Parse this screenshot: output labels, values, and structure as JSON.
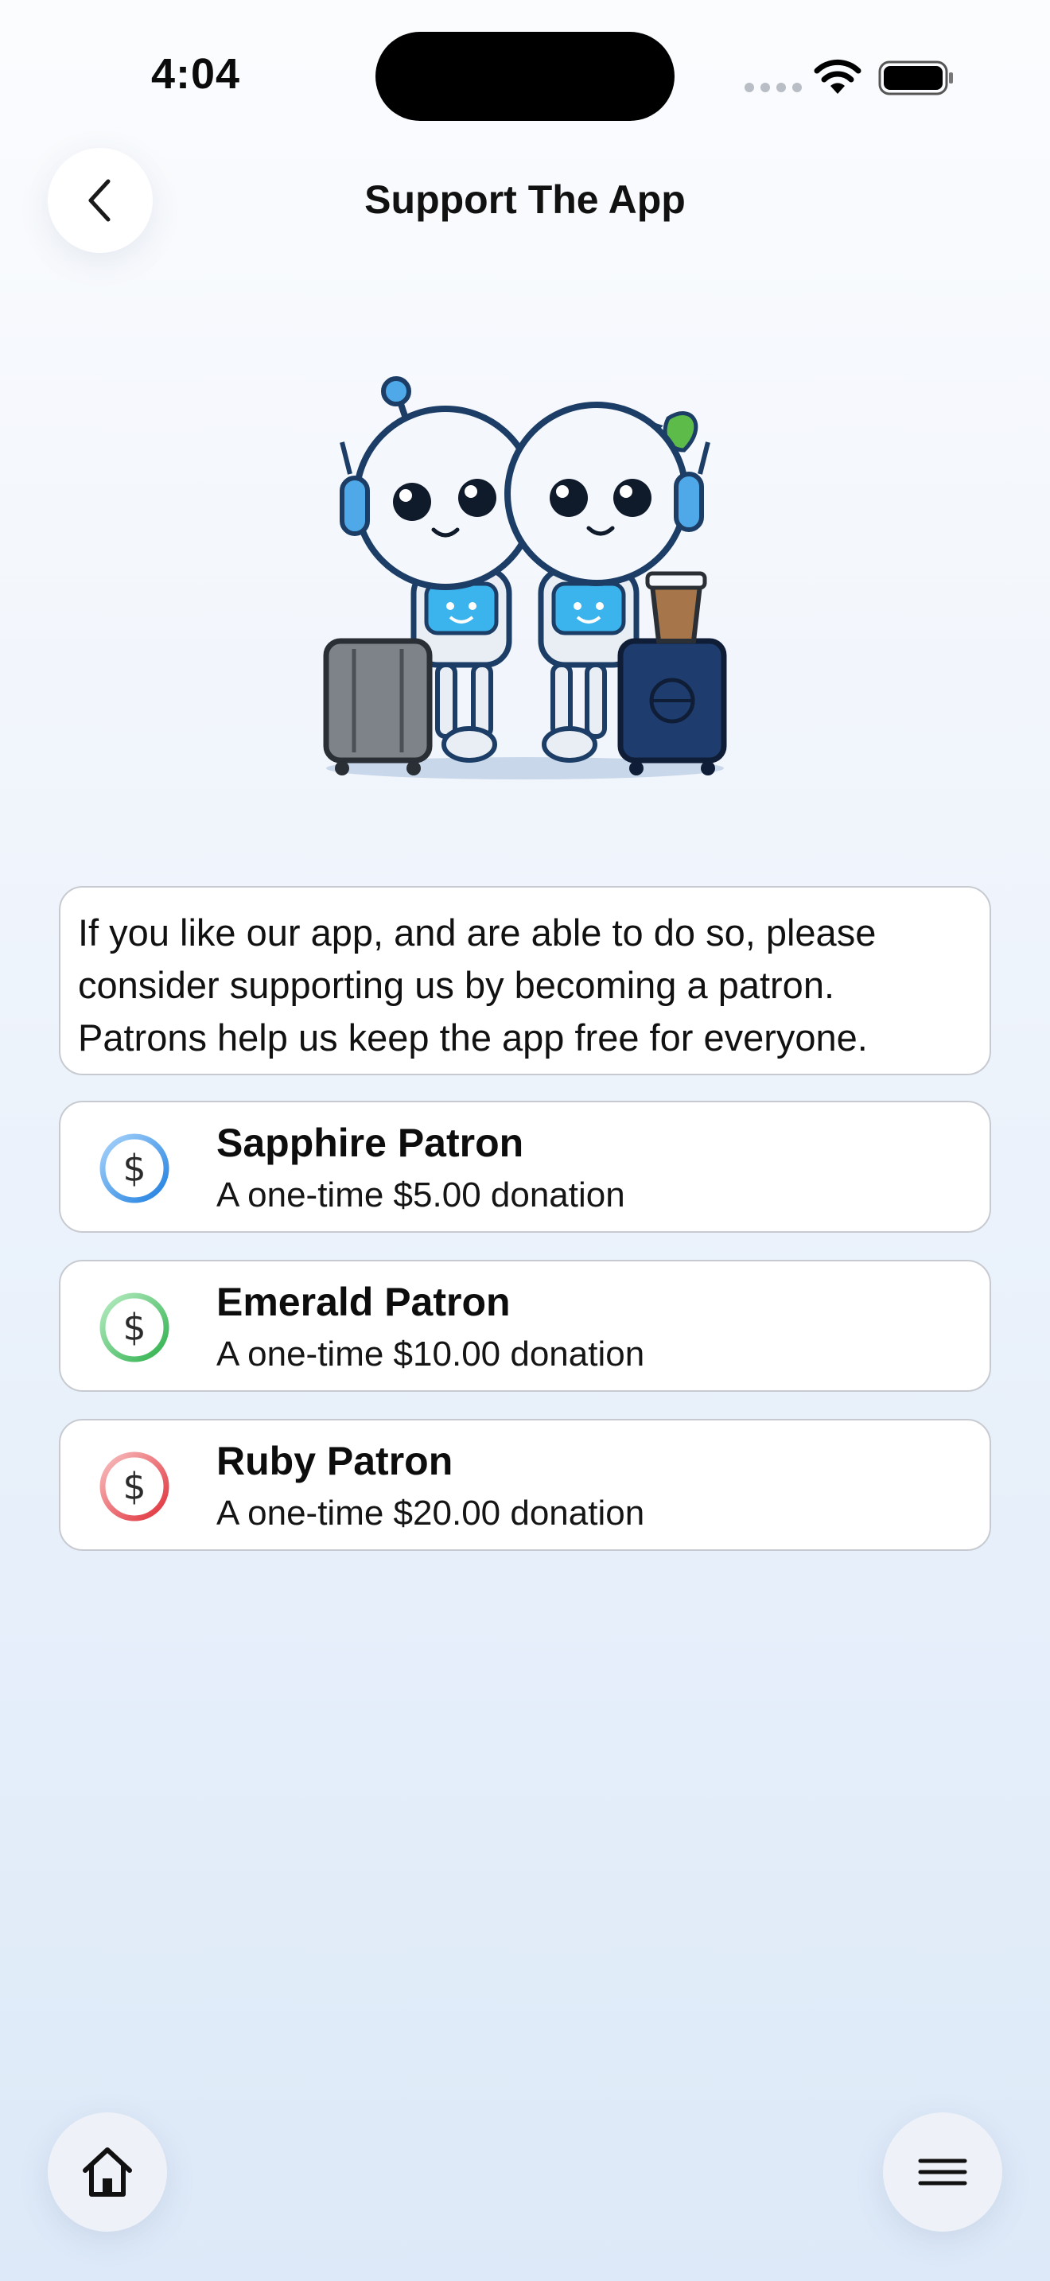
{
  "status_bar": {
    "time": "4:04"
  },
  "header": {
    "title": "Support The App",
    "back_icon": "chevron-left-icon"
  },
  "intro": {
    "text": "If you like our app, and are able to do so, please consider supporting us by becoming a patron. Patrons help us keep the app free for everyone."
  },
  "tiers": [
    {
      "title": "Sapphire Patron",
      "subtitle": "A one-time $5.00 donation",
      "icon": "dollar-icon",
      "color": "#2f8ee8"
    },
    {
      "title": "Emerald Patron",
      "subtitle": "A one-time $10.00 donation",
      "icon": "dollar-icon",
      "color": "#3fbf5a"
    },
    {
      "title": "Ruby Patron",
      "subtitle": "A one-time $20.00 donation",
      "icon": "dollar-icon",
      "color": "#e8494c"
    }
  ],
  "bottom_bar": {
    "home_icon": "home-icon",
    "menu_icon": "menu-icon"
  }
}
